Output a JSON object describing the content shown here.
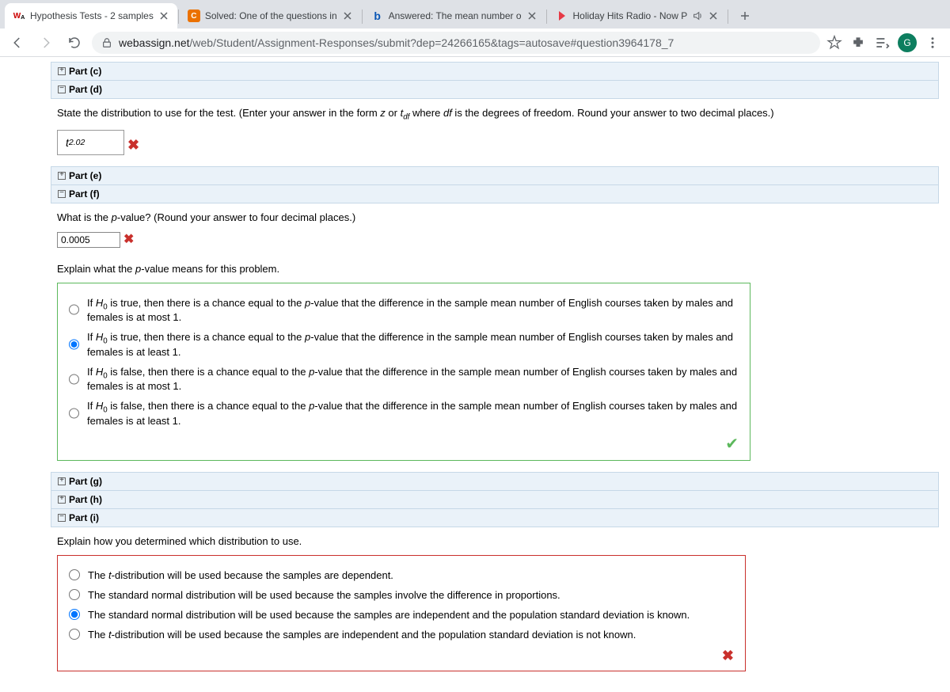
{
  "tabs": [
    {
      "title": "Hypothesis Tests - 2 samples"
    },
    {
      "title": "Solved: One of the questions in"
    },
    {
      "title": "Answered: The mean number o"
    },
    {
      "title": "Holiday Hits Radio - Now P"
    }
  ],
  "url": {
    "host": "webassign.net",
    "path": "/web/Student/Assignment-Responses/submit?dep=24266165&tags=autosave#question3964178_7"
  },
  "avatar_initial": "G",
  "parts": {
    "c": "Part (c)",
    "d": "Part (d)",
    "e": "Part (e)",
    "f": "Part (f)",
    "g": "Part (g)",
    "h": "Part (h)",
    "i": "Part (i)"
  },
  "partD": {
    "prompt_pre": "State the distribution to use for the test. (Enter your answer in the form ",
    "prompt_z": "z",
    "prompt_or": " or ",
    "prompt_t": "t",
    "prompt_sub": "df",
    "prompt_where": " where ",
    "prompt_df": "df",
    "prompt_post": " is the degrees of freedom. Round your answer to two decimal places.)",
    "answer_var": "t",
    "answer_sub": "2.02"
  },
  "partF": {
    "q1_pre": "What is the ",
    "q1_p": "p",
    "q1_post": "-value? (Round your answer to four decimal places.)",
    "input_value": "0.0005",
    "q2_pre": "Explain what the ",
    "q2_p": "p",
    "q2_post": "-value means for this problem.",
    "opts": [
      {
        "pre": "If ",
        "h": "H",
        "sub": "0",
        "mid": " is true, then there is a chance equal to the ",
        "p": "p",
        "end": "-value that the difference in the sample mean number of English courses taken by males and females is at most 1."
      },
      {
        "pre": "If ",
        "h": "H",
        "sub": "0",
        "mid": " is true, then there is a chance equal to the ",
        "p": "p",
        "end": "-value that the difference in the sample mean number of English courses taken by males and females is at least 1."
      },
      {
        "pre": "If ",
        "h": "H",
        "sub": "0",
        "mid": " is false, then there is a chance equal to the ",
        "p": "p",
        "end": "-value that the difference in the sample mean number of English courses taken by males and females is at most 1."
      },
      {
        "pre": "If ",
        "h": "H",
        "sub": "0",
        "mid": " is false, then there is a chance equal to the ",
        "p": "p",
        "end": "-value that the difference in the sample mean number of English courses taken by males and females is at least 1."
      }
    ],
    "selected": 1
  },
  "partI": {
    "prompt": "Explain how you determined which distribution to use.",
    "opts": [
      {
        "pre": "The ",
        "i": "t",
        "post": "-distribution will be used because the samples are dependent."
      },
      {
        "pre": "The standard normal distribution will be used because the samples involve the difference in proportions.",
        "i": "",
        "post": ""
      },
      {
        "pre": "The standard normal distribution will be used because the samples are independent and the population standard deviation is known.",
        "i": "",
        "post": ""
      },
      {
        "pre": "The ",
        "i": "t",
        "post": "-distribution will be used because the samples are independent and the population standard deviation is not known."
      }
    ],
    "selected": 2
  },
  "marks": {
    "x": "✖",
    "check": "✔",
    "plus": "+",
    "minus": "−"
  }
}
